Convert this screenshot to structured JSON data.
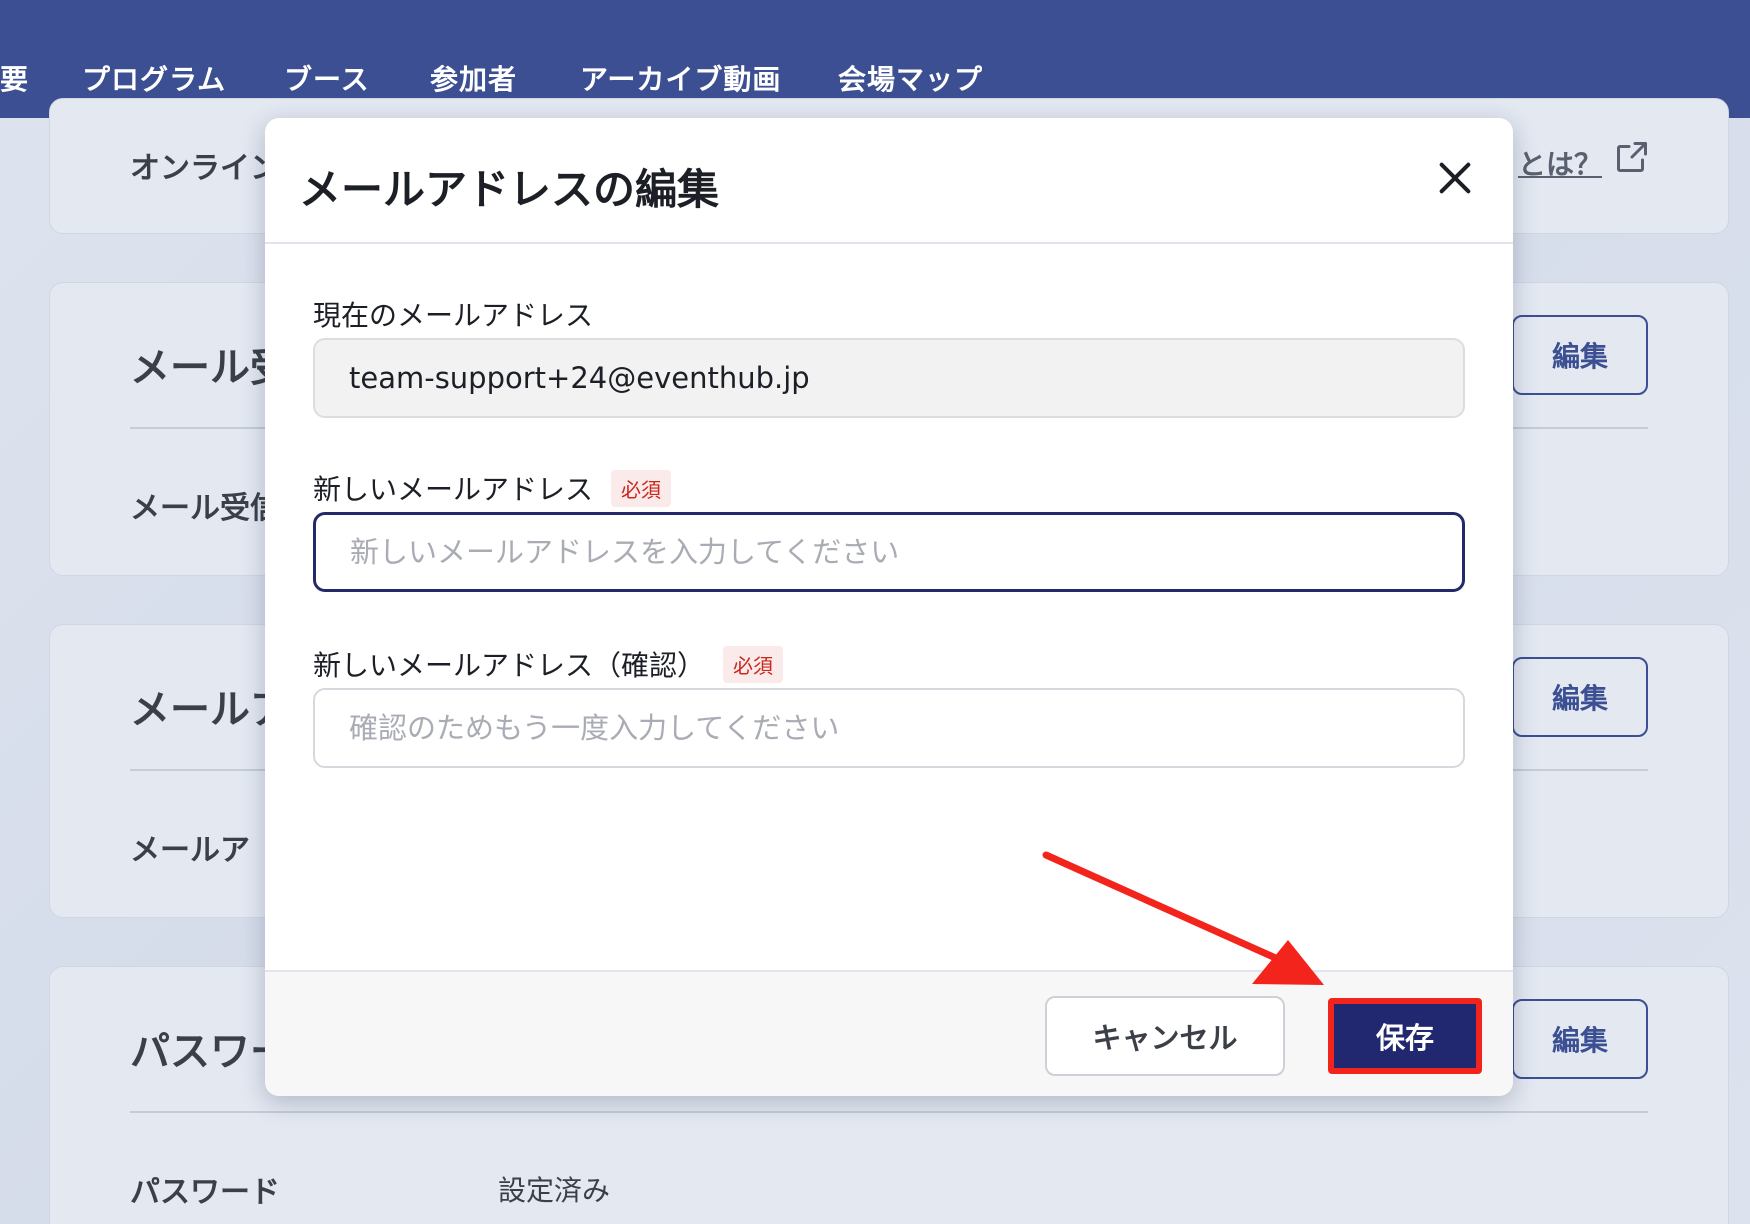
{
  "nav": {
    "items": [
      "要",
      "プログラム",
      "ブース",
      "参加者",
      "アーカイブ動画",
      "会場マップ"
    ]
  },
  "background": {
    "card1": {
      "title": "オンライン",
      "link": "とは？"
    },
    "card2": {
      "title": "メール受",
      "row_label": "メール受信",
      "edit": "編集"
    },
    "card3": {
      "title": "メールア",
      "row_label": "メールア",
      "edit": "編集"
    },
    "card4": {
      "title": "パスワー",
      "row_label": "パスワード",
      "row_value": "設定済み",
      "edit": "編集"
    }
  },
  "modal": {
    "title": "メールアドレスの編集",
    "current_label": "現在のメールアドレス",
    "current_value": "team-support+24@eventhub.jp",
    "new_label": "新しいメールアドレス",
    "new_required": "必須",
    "new_placeholder": "新しいメールアドレスを入力してください",
    "confirm_label": "新しいメールアドレス（確認）",
    "confirm_required": "必須",
    "confirm_placeholder": "確認のためもう一度入力してください",
    "cancel_label": "キャンセル",
    "save_label": "保存"
  },
  "colors": {
    "nav_bg": "#3b4f92",
    "primary": "#222870",
    "highlight": "#f3241b",
    "required": "#c8281e"
  },
  "icons": [
    "close-icon",
    "external-link-icon",
    "annotation-arrow"
  ]
}
